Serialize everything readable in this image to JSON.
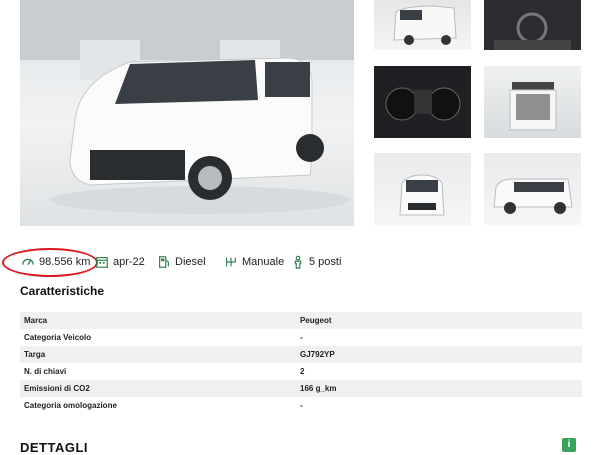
{
  "specs": {
    "mileage": "98.556 km",
    "registration": "apr-22",
    "fuel": "Diesel",
    "transmission": "Manuale",
    "seats": "5 posti"
  },
  "features_title": "Caratteristiche",
  "features": [
    {
      "label": "Marca",
      "value": "Peugeot"
    },
    {
      "label": "Categoria Veicolo",
      "value": "-"
    },
    {
      "label": "Targa",
      "value": "GJ792YP"
    },
    {
      "label": "N. di chiavi",
      "value": "2"
    },
    {
      "label": "Emissioni di CO2",
      "value": "166 g_km"
    },
    {
      "label": "Categoria omologazione",
      "value": "-"
    }
  ],
  "details_title": "DETTAGLI",
  "info_badge": "i",
  "colors": {
    "table_stripe": "#eef0f2",
    "annotation_ring": "#d9191e",
    "badge": "#3aa35b"
  }
}
